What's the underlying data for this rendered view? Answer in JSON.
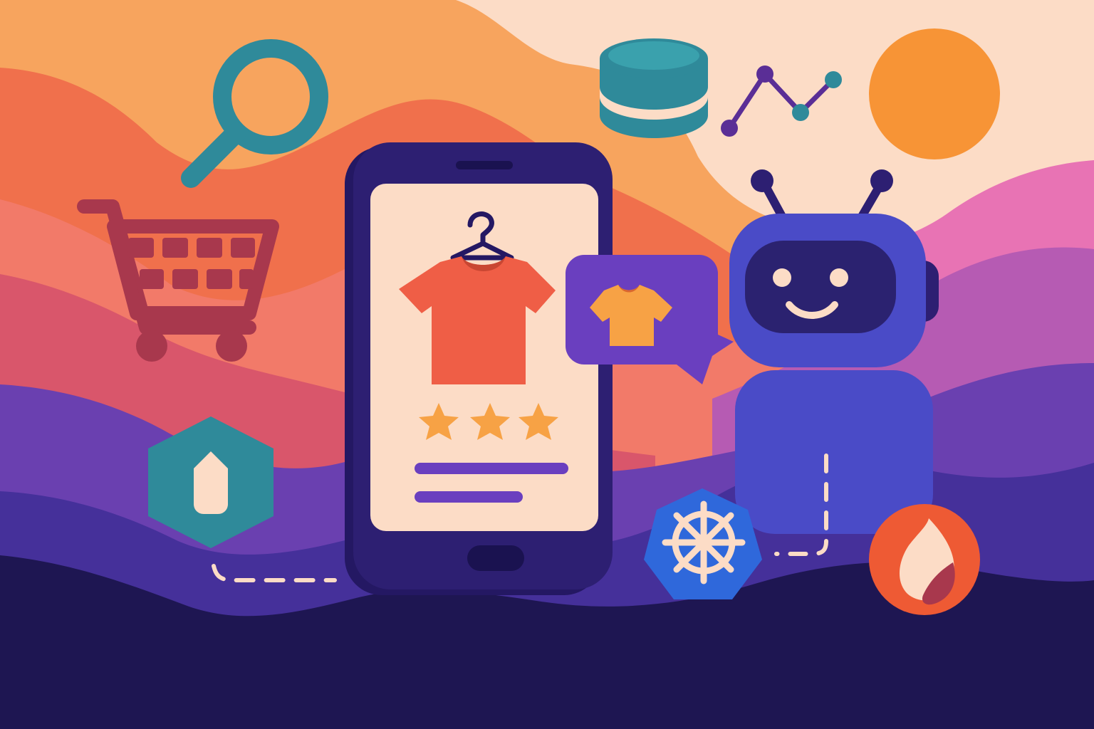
{
  "illustration": {
    "palette": {
      "sky": "#fcdcc6",
      "peach": "#f7a45e",
      "coral": "#f0704c",
      "pink_band": "#f27a69",
      "rose": "#d9566b",
      "magenta": "#e873b4",
      "orchid": "#b65bb3",
      "violet": "#6a40b0",
      "indigo": "#45309a",
      "night": "#1e1652",
      "teal": "#2f8a9a",
      "cart": "#a8384d",
      "phone": "#2d1f72",
      "screen": "#fcdcc6",
      "shirt": "#ef5e46",
      "star": "#f7a245",
      "robot": "#4a4bc7",
      "robot_face": "#2b2270",
      "sun": "#f79436",
      "kubernetes": "#2f68db",
      "flame_badge": "#ee5a34"
    },
    "icons": [
      "magnifying-glass-icon",
      "shopping-cart-icon",
      "database-icon",
      "line-chart-icon",
      "sun-icon",
      "smartphone-icon",
      "hanger-icon",
      "tshirt-icon",
      "star-icon",
      "chat-bubble-icon",
      "robot-icon",
      "tag-icon",
      "kubernetes-helm-icon",
      "flame-icon"
    ],
    "product_rating_stars": 3
  }
}
